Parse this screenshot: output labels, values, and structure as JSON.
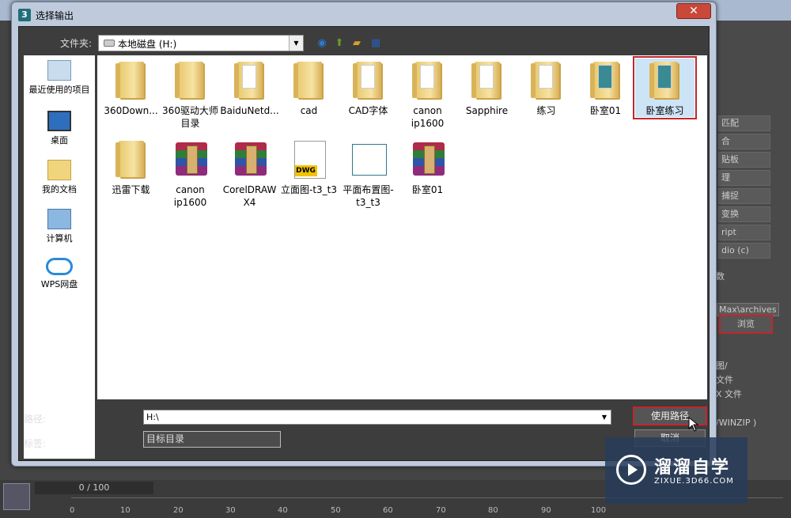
{
  "dialog": {
    "title": "选择输出",
    "close_glyph": "✕",
    "folder_label": "文件夹:",
    "folder_value": "本地磁盘 (H:)",
    "path_label": "路径:",
    "path_value": "H:\\",
    "tag_label": "标签:",
    "tag_value": "目标目录",
    "use_path_button": "使用路径",
    "cancel_button": "取消"
  },
  "places": [
    "最近使用的项目",
    "桌面",
    "我的文档",
    "计算机",
    "WPS网盘"
  ],
  "files": [
    {
      "name": "360Down...",
      "type": "folder"
    },
    {
      "name": "360驱动大师目录",
      "type": "folder"
    },
    {
      "name": "BaiduNetd...",
      "type": "folder"
    },
    {
      "name": "cad",
      "type": "folder"
    },
    {
      "name": "CAD字体",
      "type": "folder"
    },
    {
      "name": "canon ip1600",
      "type": "folder"
    },
    {
      "name": "Sapphire",
      "type": "folder"
    },
    {
      "name": "练习",
      "type": "folder"
    },
    {
      "name": "卧室01",
      "type": "folder"
    },
    {
      "name": "卧室练习",
      "type": "folder",
      "selected": true
    },
    {
      "name": "迅雷下载",
      "type": "folder"
    },
    {
      "name": "canon ip1600",
      "type": "winrar"
    },
    {
      "name": "CorelDRAW X4",
      "type": "winrar"
    },
    {
      "name": "立面图-t3_t3",
      "type": "dwg"
    },
    {
      "name": "平面布置图-t3_t3",
      "type": "plan"
    },
    {
      "name": "卧室01",
      "type": "winrar"
    }
  ],
  "background": {
    "right_panel": [
      "匹配",
      "合",
      "贴板",
      "理",
      "捕捉",
      "变换",
      "ript",
      "dio (c)"
    ],
    "right_text": [
      "数",
      "Max\\archives",
      "浏览",
      "图/",
      "文件",
      "X 文件",
      "/WINZIP )"
    ],
    "timeline_counter": "0 / 100",
    "ticks": [
      "0",
      "10",
      "20",
      "30",
      "40",
      "50",
      "60",
      "70",
      "80",
      "90",
      "100"
    ]
  },
  "watermark": {
    "title": "溜溜自学",
    "subtitle": "ZIXUE.3D66.COM"
  },
  "colors": {
    "highlight": "#c1272d",
    "dialog_frame": "#bfcbdc",
    "panel_bg": "#3d3d3d"
  }
}
